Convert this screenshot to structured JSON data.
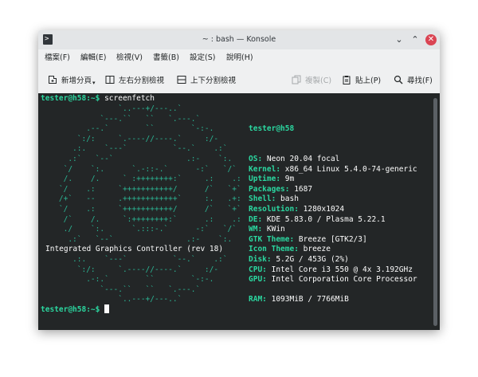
{
  "window": {
    "title": "~ : bash — Konsole"
  },
  "menu": [
    "檔案(F)",
    "編輯(E)",
    "檢視(V)",
    "書籤(B)",
    "設定(S)",
    "說明(H)"
  ],
  "toolbar": {
    "new_tab": "新增分頁",
    "split_lr": "左右分割檢視",
    "split_tb": "上下分割檢視",
    "copy": "複製(C)",
    "paste": "貼上(P)",
    "find": "尋找(F)"
  },
  "terminal": {
    "prompt": "tester@h58:~$ ",
    "command": "screenfetch",
    "logo_lines": [
      "                 `..---+/---..`",
      "             `---.``   ``   `.---.`",
      "          .--.`        ``        `-:-.",
      "        `:/:     `.----//----.`     :/-",
      "       .:.    `---`          `--.`    .:`",
      "      .:`   `--`                .:-    `:.",
      "     `/    `:.      `.-::-.`      -:`   `/`",
      "     /.    /.     ` :++++++++:`     .:    .:",
      "    `/    .:     `+++++++++++/      /`   `+`",
      "    /+`   --     .++++++++++++`     :.   .+:",
      "    `/    .:     `+++++++++++/      /`   `+`",
      "     /`    /.     `:++++++++:`      .:    .:",
      "     ./    `:.      `.:::-.`      -:`   `/`",
      "      .:`   `--`                .:-    `:."
    ],
    "logo_caption": "Integrated Graphics Controller (rev 18)",
    "logo_tail": [
      "       .:.    `---`          `--.`    .:`",
      "        `:/:     `.----//----.`     :/-",
      "          .-:.`        ``        `-:-.",
      "             `---.``   ``   `.---.`",
      "                 `..---+/---..`"
    ],
    "user_host": "tester@h58",
    "info": [
      {
        "key": "OS:",
        "value": " Neon 20.04 focal"
      },
      {
        "key": "Kernel:",
        "value": " x86_64 Linux 5.4.0-74-generic"
      },
      {
        "key": "Uptime:",
        "value": " 9m"
      },
      {
        "key": "Packages:",
        "value": " 1687"
      },
      {
        "key": "Shell:",
        "value": " bash"
      },
      {
        "key": "Resolution:",
        "value": " 1280x1024"
      },
      {
        "key": "DE:",
        "value": " KDE 5.83.0 / Plasma 5.22.1"
      },
      {
        "key": "WM:",
        "value": " KWin"
      },
      {
        "key": "GTK Theme:",
        "value": " Breeze [GTK2/3]"
      },
      {
        "key": "Icon Theme:",
        "value": " breeze"
      },
      {
        "key": "Disk:",
        "value": " 5.2G / 453G (2%)"
      },
      {
        "key": "CPU:",
        "value": " Intel Core i3 550 @ 4x 3.192GHz"
      },
      {
        "key": "GPU:",
        "value": " Intel Corporation Core Processor"
      },
      {
        "key": "RAM:",
        "value": " 1093MiB / 7766MiB"
      }
    ]
  }
}
